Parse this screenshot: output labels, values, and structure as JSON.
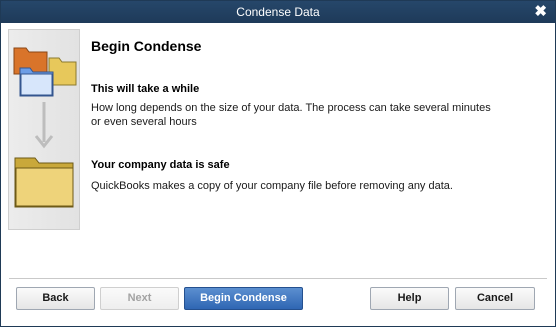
{
  "window": {
    "title": "Condense Data",
    "close_glyph": "✖"
  },
  "content": {
    "heading": "Begin Condense",
    "sections": [
      {
        "title": "This will take a while",
        "body_line1": "How long depends on the size of your data. The process can take several minutes",
        "body_line2": "or even several hours"
      },
      {
        "title": "Your company data is safe",
        "body_line1": "QuickBooks makes a copy of your company file before removing any data."
      }
    ]
  },
  "buttons": {
    "back": "Back",
    "next": "Next",
    "begin": "Begin Condense",
    "help": "Help",
    "cancel": "Cancel"
  },
  "icons": [
    "folders-stack-icon",
    "arrow-down-icon",
    "folder-icon"
  ]
}
